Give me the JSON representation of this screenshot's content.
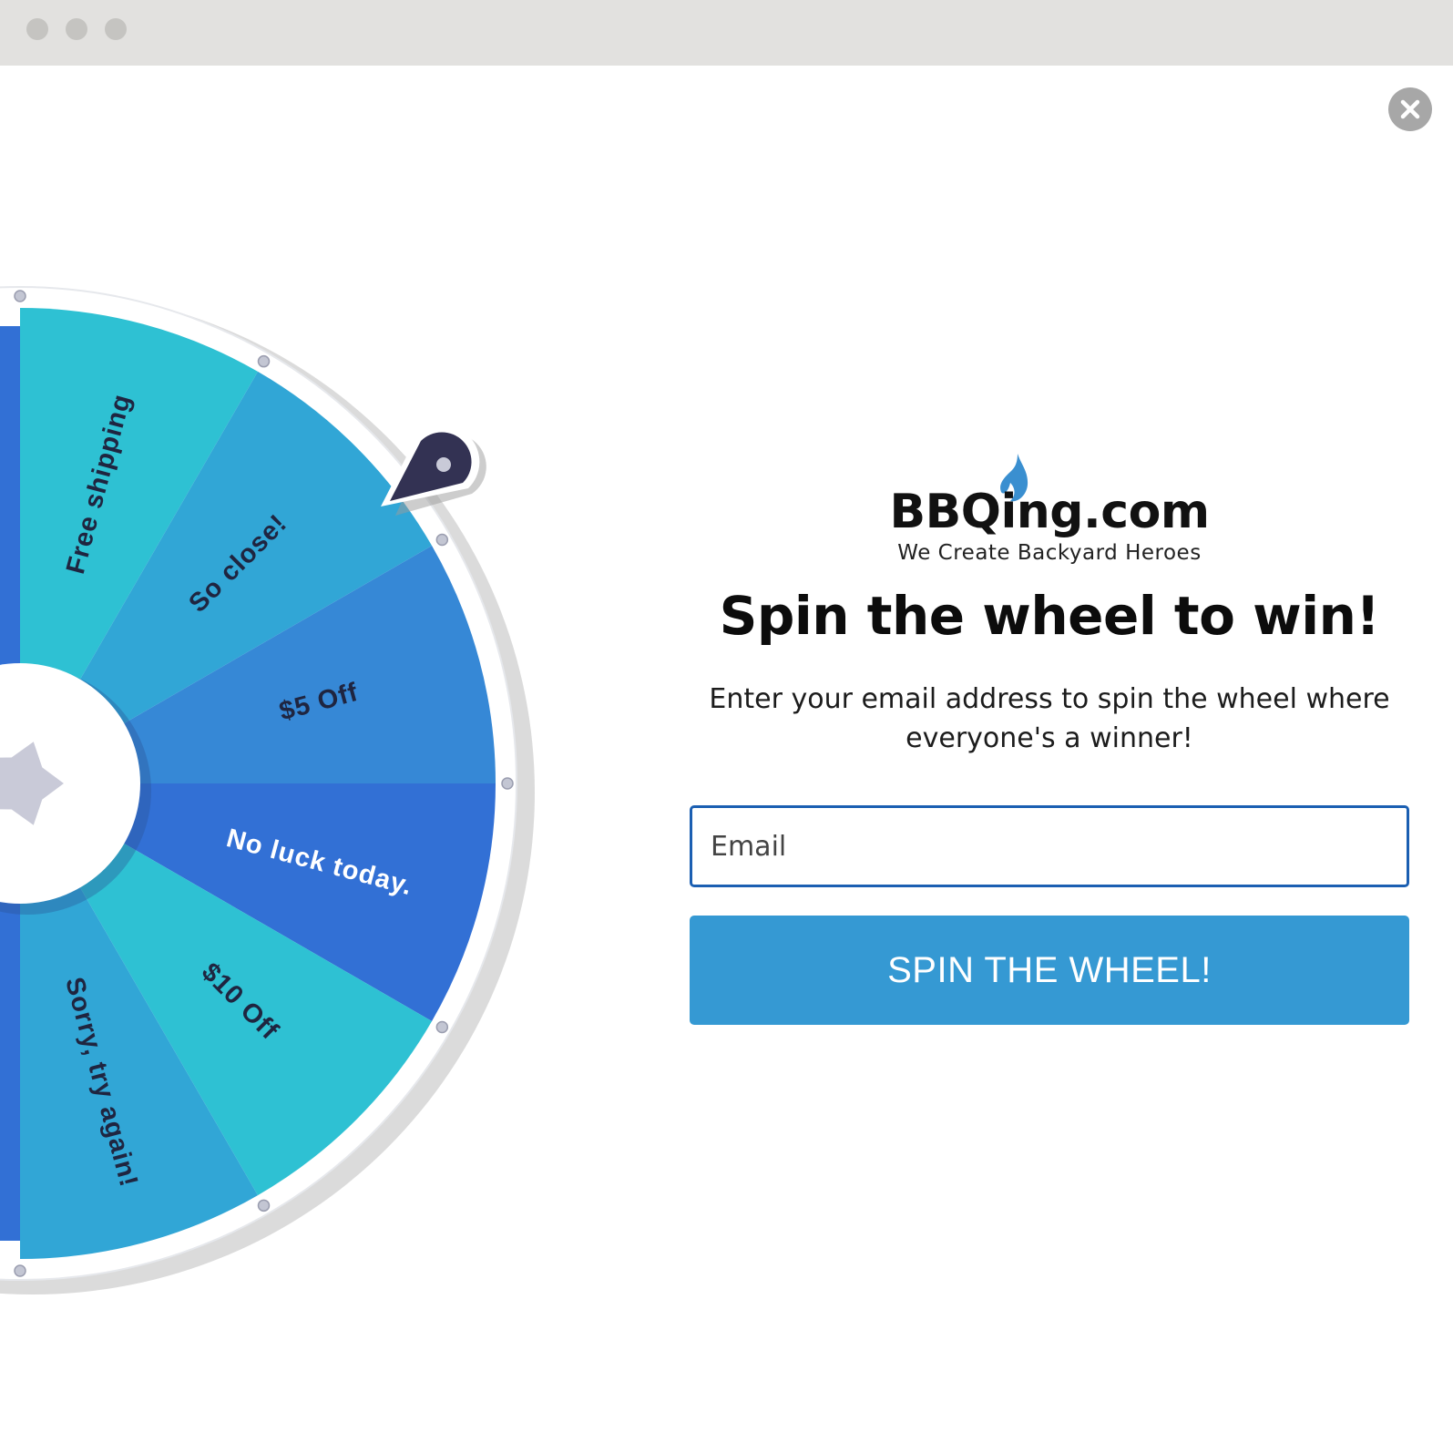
{
  "window": {
    "controls": [
      "close-dot",
      "minimize-dot",
      "maximize-dot"
    ]
  },
  "popup": {
    "close_icon": "close-icon"
  },
  "wheel": {
    "segments": [
      {
        "label": "Free shipping",
        "color": "#2ec1d3"
      },
      {
        "label": "So close!",
        "color": "#31a6d6"
      },
      {
        "label": "$5 Off",
        "color": "#3688d6"
      },
      {
        "label": "No luck today.",
        "color": "#3270d5"
      },
      {
        "label": "$10 Off",
        "color": "#2ec1d3"
      },
      {
        "label": "Sorry, try again!",
        "color": "#31a6d6"
      }
    ],
    "rim_color": "#ffffff",
    "pointer_color": "#333253",
    "hub_icon": "star-icon"
  },
  "brand": {
    "name": "BBQing.com",
    "tagline": "We Create Backyard Heroes",
    "flame_icon": "flame-icon",
    "flame_color": "#3a8fd0"
  },
  "form": {
    "headline": "Spin the wheel to win!",
    "subtext": "Enter your email address to spin the wheel where everyone's a winner!",
    "email_placeholder": "Email",
    "submit_label": "SPIN THE WHEEL!",
    "accent": "#3599d3",
    "input_border": "#1b5fb2"
  }
}
